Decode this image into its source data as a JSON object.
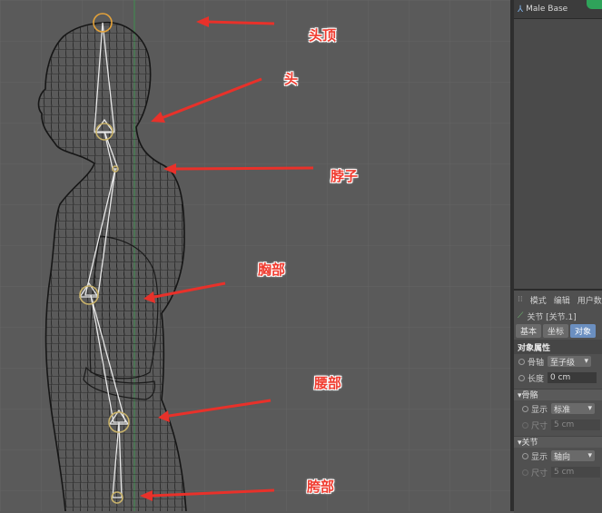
{
  "viewport": {
    "labels": {
      "head_top": "头顶",
      "head": "头",
      "neck": "脖子",
      "chest": "胸部",
      "waist": "腰部",
      "hip": "胯部"
    }
  },
  "object_manager": {
    "item_label": "Male Base",
    "tag_color": "#2fa35a"
  },
  "attribute_manager": {
    "menu": [
      "模式",
      "编辑",
      "用户数"
    ],
    "object_title": "关节 [关节.1]",
    "tabs": [
      "基本",
      "坐标",
      "对象"
    ],
    "section_title": "对象属性",
    "bone_axis_label": "骨轴",
    "bone_axis_value": "至子级",
    "length_label": "长度",
    "length_value": "0 cm",
    "bone_group": "▾骨骼",
    "bone_display_label": "显示",
    "bone_display_value": "标准",
    "bone_size_label": "尺寸",
    "bone_size_value": "5 cm",
    "joint_group": "▾关节",
    "joint_display_label": "显示",
    "joint_display_value": "轴向",
    "joint_size_label": "尺寸",
    "joint_size_value": "5 cm"
  },
  "colors": {
    "accent_tab": "#6b8fc0",
    "annotation_red": "#f03a2e",
    "joint_yellow": "#e0a030"
  }
}
